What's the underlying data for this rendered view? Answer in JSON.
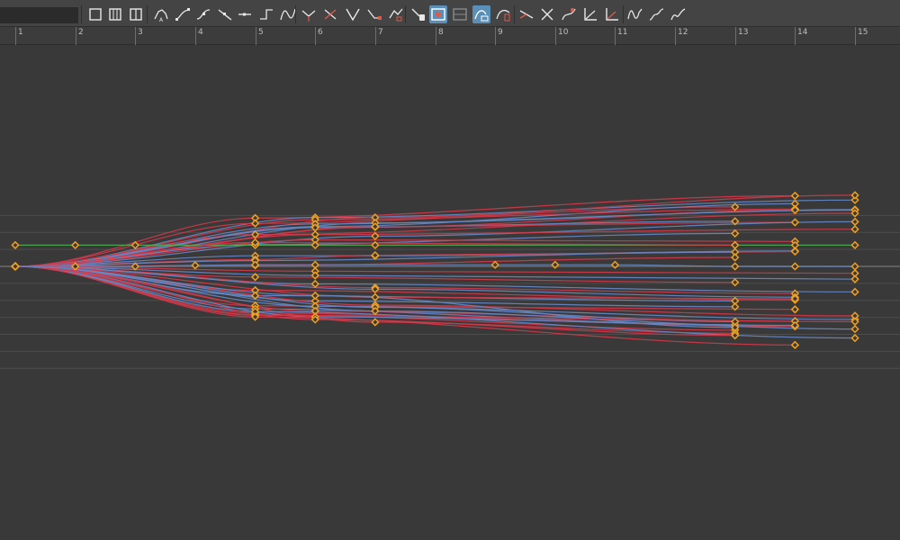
{
  "toolbar": {
    "search_value": "",
    "buttons": [
      {
        "name": "frame-all-button",
        "icon": "frame-all-icon"
      },
      {
        "name": "frame-selection-button",
        "icon": "frame-selection-icon"
      },
      {
        "name": "frame-playback-range-button",
        "icon": "frame-playback-range-icon"
      },
      {
        "name": "auto-tangent-button",
        "icon": "auto-tangent-icon"
      },
      {
        "name": "spline-tangent-button",
        "icon": "spline-tangent-icon"
      },
      {
        "name": "clamped-tangent-button",
        "icon": "clamped-tangent-icon"
      },
      {
        "name": "linear-tangent-button",
        "icon": "linear-tangent-icon"
      },
      {
        "name": "flat-tangent-button",
        "icon": "flat-tangent-icon"
      },
      {
        "name": "step-tangent-button",
        "icon": "step-tangent-icon"
      },
      {
        "name": "plateau-tangent-button",
        "icon": "plateau-tangent-icon"
      },
      {
        "name": "break-tangents-button",
        "icon": "break-tangents-icon"
      },
      {
        "name": "unify-tangents-button",
        "icon": "unify-tangents-icon"
      },
      {
        "name": "free-tangent-weight-button",
        "icon": "free-tangent-weight-icon"
      },
      {
        "name": "lock-tangent-weight-button",
        "icon": "lock-tangent-weight-icon"
      },
      {
        "name": "key-stats-button",
        "icon": "key-stats-icon"
      },
      {
        "name": "insert-keys-button",
        "icon": "insert-keys-icon"
      },
      {
        "name": "time-snap-button",
        "icon": "time-snap-icon",
        "active": true
      },
      {
        "name": "value-snap-button",
        "icon": "value-snap-icon"
      },
      {
        "name": "normalize-curves-button",
        "icon": "normalize-curves-icon",
        "active": true
      },
      {
        "name": "denormalize-curves-button",
        "icon": "denormalize-curves-icon"
      },
      {
        "name": "buffer-curve-snapshot-button",
        "icon": "buffer-curve-snapshot-icon"
      },
      {
        "name": "swap-buffer-curve-button",
        "icon": "swap-buffer-curve-icon"
      },
      {
        "name": "retime-tool-button",
        "icon": "retime-tool-icon"
      },
      {
        "name": "lattice-deform-button",
        "icon": "lattice-deform-icon"
      },
      {
        "name": "pre-infinity-cycle-button",
        "icon": "pre-infinity-cycle-icon"
      },
      {
        "name": "post-infinity-cycle-button",
        "icon": "post-infinity-cycle-icon"
      },
      {
        "name": "cycle-with-offset-button",
        "icon": "cycle-with-offset-icon"
      },
      {
        "name": "oscillate-curve-button",
        "icon": "oscillate-curve-icon"
      }
    ]
  },
  "ruler": {
    "frames": [
      "1",
      "2",
      "3",
      "4",
      "5",
      "6",
      "7",
      "8",
      "9",
      "10",
      "11",
      "12",
      "13",
      "14",
      "15"
    ]
  },
  "colors": {
    "background": "#393939",
    "grid_line": "#4d4d4d",
    "zero_line": "#6b6b6b",
    "curve_red": "#d03a4a",
    "curve_blue": "#6688c6",
    "curve_green": "#4faa55",
    "key_outline": "#f0a020"
  },
  "graph": {
    "x_range": [
      1,
      15
    ],
    "value_range": [
      -1,
      1
    ],
    "horizontal_grid_values": [
      0.96,
      0.64,
      0.32,
      0,
      -0.32,
      -0.64,
      -0.96,
      -1.28,
      -1.6,
      -1.92
    ],
    "curves": [
      {
        "color": "red",
        "keys": [
          [
            1,
            0
          ],
          [
            5,
            0.91
          ],
          [
            14,
            1.33
          ]
        ]
      },
      {
        "color": "blue",
        "keys": [
          [
            1,
            0
          ],
          [
            6,
            0.92
          ],
          [
            15,
            1.25
          ]
        ]
      },
      {
        "color": "red",
        "keys": [
          [
            1,
            0
          ],
          [
            7,
            0.92
          ],
          [
            15,
            1.34
          ]
        ]
      },
      {
        "color": "red",
        "keys": [
          [
            1,
            0
          ],
          [
            5,
            0.81
          ],
          [
            13,
            1.12
          ]
        ]
      },
      {
        "color": "blue",
        "keys": [
          [
            1,
            0
          ],
          [
            6,
            0.75
          ],
          [
            14,
            1.18
          ]
        ]
      },
      {
        "color": "red",
        "keys": [
          [
            1,
            0
          ],
          [
            6,
            0.88
          ],
          [
            14,
            1.08
          ]
        ]
      },
      {
        "color": "blue",
        "keys": [
          [
            1,
            0
          ],
          [
            7,
            0.82
          ],
          [
            15,
            1.07
          ]
        ]
      },
      {
        "color": "red",
        "keys": [
          [
            1,
            0
          ],
          [
            7,
            0.74
          ],
          [
            14,
            1.06
          ]
        ]
      },
      {
        "color": "blue",
        "keys": [
          [
            1,
            0
          ],
          [
            6,
            0.8
          ],
          [
            15,
            1.06
          ]
        ]
      },
      {
        "color": "red",
        "keys": [
          [
            1,
            0
          ],
          [
            5,
            0.6
          ],
          [
            15,
            1.0
          ]
        ]
      },
      {
        "color": "blue",
        "keys": [
          [
            1,
            0
          ],
          [
            6,
            0.73
          ],
          [
            13,
            0.85
          ]
        ]
      },
      {
        "color": "red",
        "keys": [
          [
            1,
            0
          ],
          [
            7,
            0.75
          ],
          [
            14,
            0.83
          ]
        ]
      },
      {
        "color": "blue",
        "keys": [
          [
            1,
            0
          ],
          [
            7,
            0.57
          ],
          [
            15,
            0.84
          ]
        ]
      },
      {
        "color": "red",
        "keys": [
          [
            1,
            0
          ],
          [
            6,
            0.6
          ],
          [
            15,
            0.7
          ]
        ]
      },
      {
        "color": "blue",
        "keys": [
          [
            1,
            0
          ],
          [
            5,
            0.41
          ],
          [
            13,
            0.62
          ]
        ]
      },
      {
        "color": "red",
        "keys": [
          [
            1,
            0
          ],
          [
            6,
            0.5
          ],
          [
            14,
            0.47
          ]
        ]
      },
      {
        "color": "green",
        "keys": [
          [
            1,
            0.4
          ],
          [
            2,
            0.4
          ],
          [
            3,
            0.4
          ],
          [
            5,
            0.4
          ],
          [
            6,
            0.4
          ],
          [
            7,
            0.4
          ],
          [
            13,
            0.4
          ],
          [
            14,
            0.4
          ],
          [
            15,
            0.4
          ]
        ]
      },
      {
        "color": "red",
        "keys": [
          [
            1,
            0
          ],
          [
            5,
            0.45
          ],
          [
            13,
            0.4
          ]
        ]
      },
      {
        "color": "blue",
        "keys": [
          [
            1,
            0
          ],
          [
            5,
            0.2
          ],
          [
            7,
            0.2
          ],
          [
            14,
            0.29
          ]
        ]
      },
      {
        "color": "red",
        "keys": [
          [
            1,
            0
          ],
          [
            5,
            0.13
          ],
          [
            7,
            0.21
          ],
          [
            14,
            0.28
          ]
        ]
      },
      {
        "color": "blue",
        "keys": [
          [
            1,
            0
          ],
          [
            5,
            0.11
          ],
          [
            13,
            0.27
          ]
        ]
      },
      {
        "color": "red",
        "keys": [
          [
            1,
            0
          ],
          [
            5,
            0.02
          ],
          [
            13,
            0.17
          ]
        ]
      },
      {
        "color": "blue",
        "keys": [
          [
            1,
            0
          ],
          [
            2,
            0
          ],
          [
            3,
            0
          ],
          [
            4,
            0.02
          ],
          [
            5,
            0.03
          ],
          [
            6,
            0.03
          ],
          [
            9,
            0.03
          ],
          [
            10,
            0.03
          ],
          [
            11,
            0.03
          ],
          [
            13,
            0
          ],
          [
            14,
            0
          ],
          [
            15,
            0
          ]
        ]
      },
      {
        "color": "red",
        "keys": [
          [
            1,
            0
          ],
          [
            6,
            -0.09
          ],
          [
            15,
            -0.13
          ]
        ]
      },
      {
        "color": "blue",
        "keys": [
          [
            1,
            0
          ],
          [
            6,
            -0.17
          ],
          [
            15,
            -0.24
          ]
        ]
      },
      {
        "color": "red",
        "keys": [
          [
            1,
            0
          ],
          [
            5,
            -0.2
          ],
          [
            13,
            -0.3
          ]
        ]
      },
      {
        "color": "blue",
        "keys": [
          [
            1,
            0
          ],
          [
            6,
            -0.33
          ],
          [
            15,
            -0.48
          ]
        ]
      },
      {
        "color": "red",
        "keys": [
          [
            1,
            0
          ],
          [
            7,
            -0.4
          ],
          [
            14,
            -0.51
          ]
        ]
      },
      {
        "color": "blue",
        "keys": [
          [
            1,
            0
          ],
          [
            7,
            -0.43
          ],
          [
            14,
            -0.58
          ]
        ]
      },
      {
        "color": "red",
        "keys": [
          [
            1,
            0
          ],
          [
            5,
            -0.45
          ],
          [
            14,
            -0.63
          ]
        ]
      },
      {
        "color": "blue",
        "keys": [
          [
            1,
            0
          ],
          [
            5,
            -0.55
          ],
          [
            13,
            -0.65
          ]
        ]
      },
      {
        "color": "red",
        "keys": [
          [
            1,
            0
          ],
          [
            7,
            -0.58
          ],
          [
            14,
            -0.61
          ]
        ]
      },
      {
        "color": "blue",
        "keys": [
          [
            1,
            0
          ],
          [
            6,
            -0.65
          ],
          [
            13,
            -0.76
          ]
        ]
      },
      {
        "color": "red",
        "keys": [
          [
            1,
            0
          ],
          [
            5,
            -0.74
          ],
          [
            14,
            -0.81
          ]
        ]
      },
      {
        "color": "blue",
        "keys": [
          [
            1,
            0
          ],
          [
            6,
            -0.75
          ],
          [
            15,
            -1.0
          ]
        ]
      },
      {
        "color": "red",
        "keys": [
          [
            1,
            0
          ],
          [
            7,
            -0.73
          ],
          [
            15,
            -0.93
          ]
        ]
      },
      {
        "color": "blue",
        "keys": [
          [
            1,
            0
          ],
          [
            5,
            -0.8
          ],
          [
            13,
            -1.1
          ]
        ]
      },
      {
        "color": "red",
        "keys": [
          [
            1,
            0
          ],
          [
            6,
            -0.84
          ],
          [
            14,
            -1.03
          ]
        ]
      },
      {
        "color": "blue",
        "keys": [
          [
            1,
            0
          ],
          [
            7,
            -0.77
          ],
          [
            13,
            -1.04
          ]
        ]
      },
      {
        "color": "red",
        "keys": [
          [
            1,
            0
          ],
          [
            5,
            -0.88
          ],
          [
            14,
            -1.13
          ]
        ]
      },
      {
        "color": "blue",
        "keys": [
          [
            1,
            0
          ],
          [
            7,
            -0.84
          ],
          [
            15,
            -1.18
          ]
        ]
      },
      {
        "color": "red",
        "keys": [
          [
            1,
            0
          ],
          [
            5,
            -0.91
          ],
          [
            13,
            -1.2
          ]
        ]
      },
      {
        "color": "blue",
        "keys": [
          [
            1,
            0
          ],
          [
            6,
            -0.95
          ],
          [
            14,
            -1.11
          ]
        ]
      },
      {
        "color": "red",
        "keys": [
          [
            1,
            0
          ],
          [
            5,
            -0.92
          ],
          [
            15,
            -1.04
          ]
        ]
      },
      {
        "color": "red",
        "keys": [
          [
            1,
            0
          ],
          [
            7,
            -1.05
          ],
          [
            13,
            -1.26
          ]
        ]
      },
      {
        "color": "blue",
        "keys": [
          [
            1,
            0
          ],
          [
            5,
            -0.85
          ],
          [
            15,
            -1.35
          ]
        ]
      },
      {
        "color": "red",
        "keys": [
          [
            1,
            0
          ],
          [
            6,
            -1.0
          ],
          [
            13,
            -1.3
          ]
        ]
      },
      {
        "color": "red",
        "keys": [
          [
            1,
            0
          ],
          [
            5,
            -0.95
          ],
          [
            14,
            -1.48
          ]
        ]
      },
      {
        "color": "blue",
        "keys": [
          [
            1,
            0
          ],
          [
            6,
            -0.55
          ],
          [
            13,
            -1.15
          ]
        ]
      }
    ]
  }
}
